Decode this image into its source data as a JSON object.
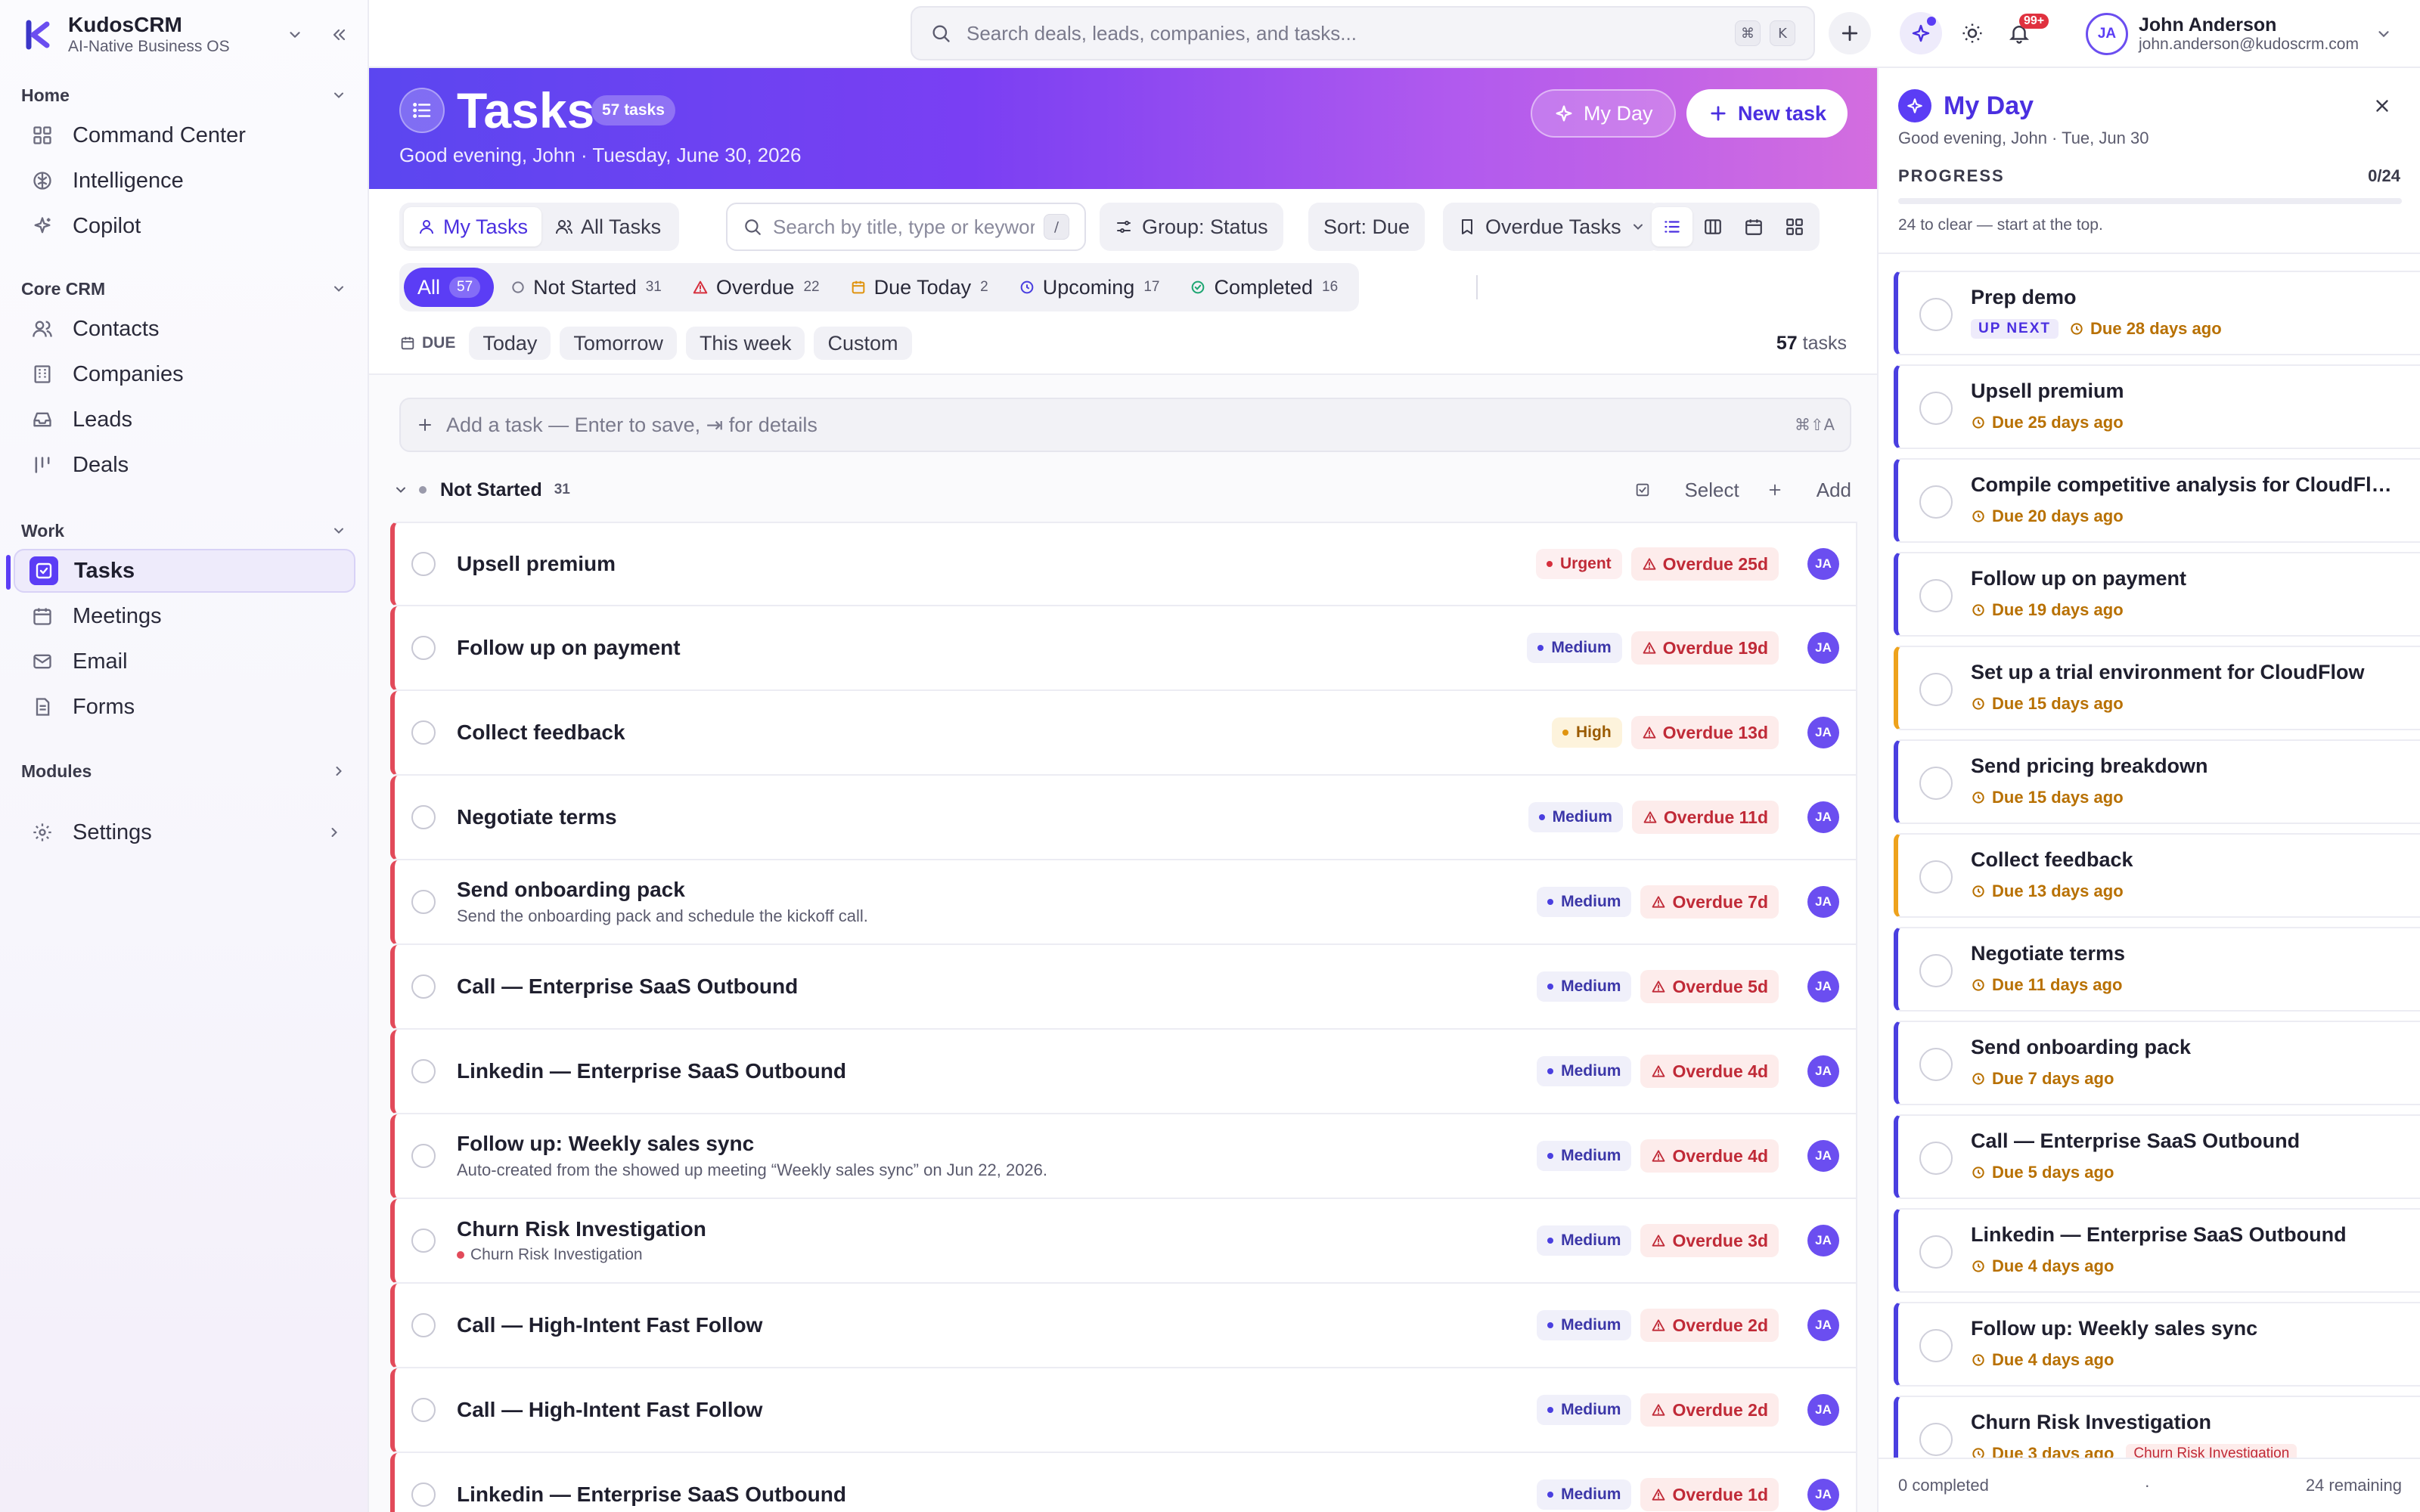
{
  "brand": {
    "name": "KudosCRM",
    "tagline": "AI-Native Business OS"
  },
  "sidebar": {
    "sections": [
      {
        "title": "Home",
        "items": [
          {
            "label": "Command Center",
            "icon": "grid-icon"
          },
          {
            "label": "Intelligence",
            "icon": "brain-icon"
          },
          {
            "label": "Copilot",
            "icon": "sparkle-icon"
          }
        ]
      },
      {
        "title": "Core CRM",
        "items": [
          {
            "label": "Contacts",
            "icon": "contacts-icon"
          },
          {
            "label": "Companies",
            "icon": "building-icon"
          },
          {
            "label": "Leads",
            "icon": "inbox-icon"
          },
          {
            "label": "Deals",
            "icon": "pipeline-icon"
          }
        ]
      },
      {
        "title": "Work",
        "items": [
          {
            "label": "Tasks",
            "icon": "checkbox-icon",
            "active": true
          },
          {
            "label": "Meetings",
            "icon": "calendar-icon"
          },
          {
            "label": "Email",
            "icon": "mail-icon"
          },
          {
            "label": "Forms",
            "icon": "document-icon"
          }
        ]
      },
      {
        "title": "Modules",
        "items": []
      }
    ],
    "settings_label": "Settings"
  },
  "topbar": {
    "search_placeholder": "Search deals, leads, companies, and tasks...",
    "shortcut_keys": [
      "⌘",
      "K"
    ],
    "notification_badge": "99+",
    "user": {
      "initials": "JA",
      "name": "John Anderson",
      "email": "john.anderson@kudoscrm.com"
    }
  },
  "hero": {
    "title": "Tasks",
    "badge": "57 tasks",
    "subtitle": "Good evening, John · Tuesday, June 30, 2026",
    "my_day_label": "My Day",
    "new_task_label": "New task"
  },
  "toolbar": {
    "my_tasks": "My Tasks",
    "all_tasks": "All Tasks",
    "search_placeholder": "Search by title, type or keyword",
    "search_shortcut": "/",
    "group_label": "Group: Status",
    "sort_label": "Sort: Due",
    "filter_label": "Overdue Tasks"
  },
  "status_tabs": [
    {
      "label": "All",
      "count": "57",
      "active": true
    },
    {
      "label": "Not Started",
      "count": "31"
    },
    {
      "label": "Overdue",
      "count": "22"
    },
    {
      "label": "Due Today",
      "count": "2"
    },
    {
      "label": "Upcoming",
      "count": "17"
    },
    {
      "label": "Completed",
      "count": "16"
    }
  ],
  "due_filter": {
    "label": "DUE",
    "options": [
      "Today",
      "Tomorrow",
      "This week",
      "Custom"
    ],
    "count_number": "57",
    "count_suffix": " tasks"
  },
  "quick_add": {
    "placeholder": "Add a task — Enter to save, ⇥ for details",
    "shortcut": "⌘⇧A"
  },
  "group": {
    "title": "Not Started",
    "count": "31",
    "select_label": "Select",
    "add_label": "Add"
  },
  "tasks": [
    {
      "title": "Upsell premium",
      "priority": "Urgent",
      "overdue": "Overdue 25d",
      "assignee": "JA"
    },
    {
      "title": "Follow up on payment",
      "priority": "Medium",
      "overdue": "Overdue 19d",
      "assignee": "JA"
    },
    {
      "title": "Collect feedback",
      "priority": "High",
      "overdue": "Overdue 13d",
      "assignee": "JA"
    },
    {
      "title": "Negotiate terms",
      "priority": "Medium",
      "overdue": "Overdue 11d",
      "assignee": "JA"
    },
    {
      "title": "Send onboarding pack",
      "desc": "Send the onboarding pack and schedule the kickoff call.",
      "priority": "Medium",
      "overdue": "Overdue 7d",
      "assignee": "JA"
    },
    {
      "title": "Call — Enterprise SaaS Outbound",
      "priority": "Medium",
      "overdue": "Overdue 5d",
      "assignee": "JA"
    },
    {
      "title": "Linkedin — Enterprise SaaS Outbound",
      "priority": "Medium",
      "overdue": "Overdue 4d",
      "assignee": "JA"
    },
    {
      "title": "Follow up: Weekly sales sync",
      "desc": "Auto-created from the showed up meeting “Weekly sales sync” on Jun 22, 2026.",
      "priority": "Medium",
      "overdue": "Overdue 4d",
      "assignee": "JA"
    },
    {
      "title": "Churn Risk Investigation",
      "tag": "Churn Risk Investigation",
      "priority": "Medium",
      "overdue": "Overdue 3d",
      "assignee": "JA"
    },
    {
      "title": "Call — High-Intent Fast Follow",
      "priority": "Medium",
      "overdue": "Overdue 2d",
      "assignee": "JA"
    },
    {
      "title": "Call — High-Intent Fast Follow",
      "priority": "Medium",
      "overdue": "Overdue 2d",
      "assignee": "JA"
    },
    {
      "title": "Linkedin — Enterprise SaaS Outbound",
      "priority": "Medium",
      "overdue": "Overdue 1d",
      "assignee": "JA"
    }
  ],
  "my_day": {
    "title": "My Day",
    "subtitle": "Good evening, John · Tue, Jun 30",
    "progress_label": "PROGRESS",
    "progress_value": "0/24",
    "progress_fraction": 0,
    "hint": "24 to clear — start at the top.",
    "items": [
      {
        "title": "Prep demo",
        "up_next": "UP NEXT",
        "due": "Due 28 days ago",
        "accent": "indigo"
      },
      {
        "title": "Upsell premium",
        "due": "Due 25 days ago",
        "accent": "indigo"
      },
      {
        "title": "Compile competitive analysis for CloudFlow",
        "due": "Due 20 days ago",
        "accent": "indigo"
      },
      {
        "title": "Follow up on payment",
        "due": "Due 19 days ago",
        "accent": "indigo"
      },
      {
        "title": "Set up a trial environment for CloudFlow",
        "due": "Due 15 days ago",
        "accent": "amber"
      },
      {
        "title": "Send pricing breakdown",
        "due": "Due 15 days ago",
        "accent": "indigo"
      },
      {
        "title": "Collect feedback",
        "due": "Due 13 days ago",
        "accent": "amber"
      },
      {
        "title": "Negotiate terms",
        "due": "Due 11 days ago",
        "accent": "indigo"
      },
      {
        "title": "Send onboarding pack",
        "due": "Due 7 days ago",
        "accent": "indigo"
      },
      {
        "title": "Call — Enterprise SaaS Outbound",
        "due": "Due 5 days ago",
        "accent": "indigo"
      },
      {
        "title": "Linkedin — Enterprise SaaS Outbound",
        "due": "Due 4 days ago",
        "accent": "indigo"
      },
      {
        "title": "Follow up: Weekly sales sync",
        "due": "Due 4 days ago",
        "accent": "indigo"
      },
      {
        "title": "Churn Risk Investigation",
        "due": "Due 3 days ago",
        "risk": "Churn Risk Investigation",
        "accent": "indigo"
      }
    ],
    "footer_left": "0 completed",
    "footer_mid": "·",
    "footer_right": "24 remaining"
  },
  "colors": {
    "accent": "#5b3df5",
    "overdue": "#c02a37",
    "urgent": "#d62f3d",
    "high": "#e09410",
    "medium": "#4a3fe0"
  }
}
